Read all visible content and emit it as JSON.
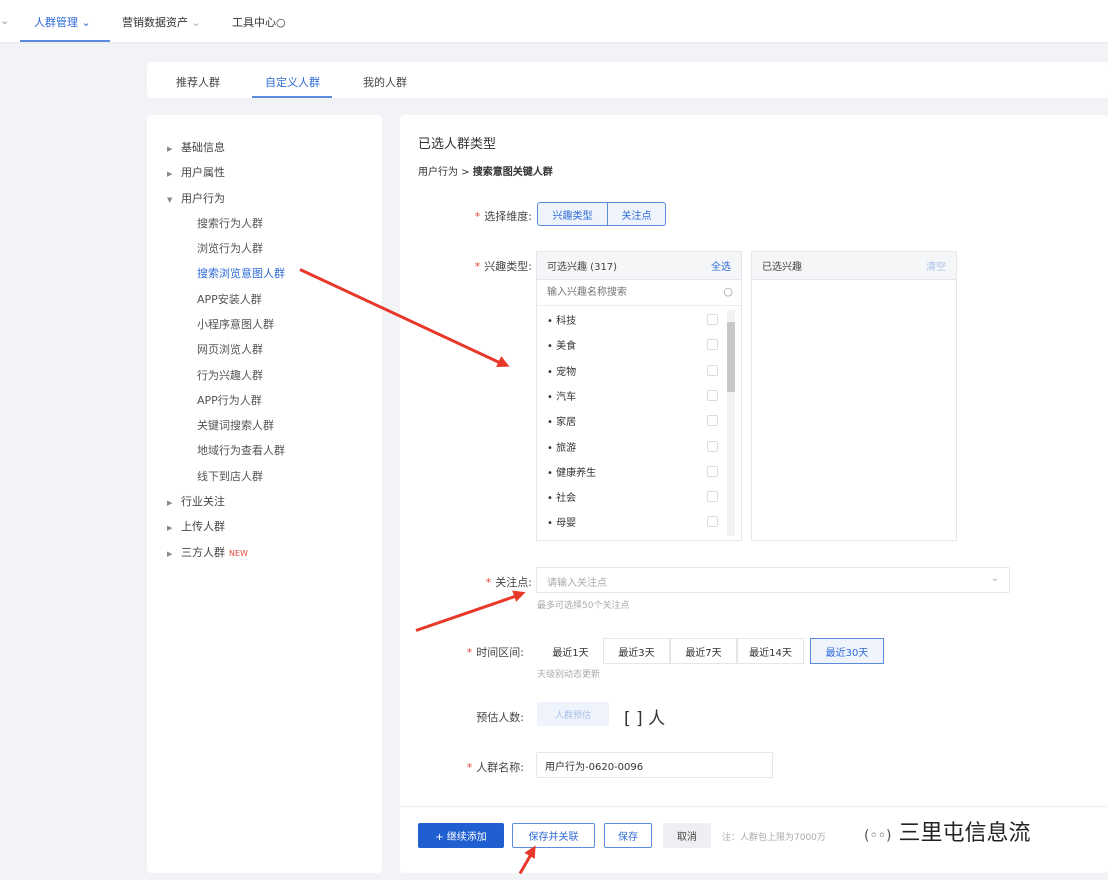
{
  "topnav": {
    "items": [
      {
        "label": "人群管理",
        "active": true
      },
      {
        "label": "营销数据资产"
      },
      {
        "label": "工具中心"
      }
    ]
  },
  "tabs": [
    {
      "label": "推荐人群"
    },
    {
      "label": "自定义人群",
      "active": true
    },
    {
      "label": "我的人群"
    }
  ],
  "tree": {
    "groups": [
      {
        "label": "基础信息"
      },
      {
        "label": "用户属性"
      },
      {
        "label": "用户行为",
        "expanded": true
      }
    ],
    "children": [
      "搜索行为人群",
      "浏览行为人群",
      "搜索浏览意图人群",
      "APP安装人群",
      "小程序意图人群",
      "网页浏览人群",
      "行为兴趣人群",
      "APP行为人群",
      "关键词搜索人群",
      "地域行为查看人群",
      "线下到店人群"
    ],
    "after": [
      "行业关注",
      "上传人群",
      "三方人群"
    ],
    "new_badge": "NEW"
  },
  "main": {
    "title": "已选人群类型",
    "breadcrumb_parent": "用户行为",
    "breadcrumb_sep": ">",
    "breadcrumb_current": "搜索意图关键人群",
    "dimension": {
      "label": "选择维度:",
      "options": [
        "兴趣类型",
        "关注点"
      ]
    },
    "interest": {
      "label": "兴趣类型:",
      "available_title": "可选兴趣 (317)",
      "select_all": "全选",
      "selected_title": "已选兴趣",
      "clear": "清空",
      "search_placeholder": "输入兴趣名称搜索",
      "items": [
        "科技",
        "美食",
        "宠物",
        "汽车",
        "家居",
        "旅游",
        "健康养生",
        "社会",
        "母婴"
      ]
    },
    "focus": {
      "label": "关注点:",
      "placeholder": "请输入关注点",
      "hint": "最多可选择50个关注点"
    },
    "time": {
      "label": "时间区间:",
      "options": [
        "最近1天",
        "最近3天",
        "最近7天",
        "最近14天",
        "最近30天"
      ],
      "selected": "最近30天",
      "hint": "天级别动态更新"
    },
    "estimate": {
      "label": "预估人数:",
      "button": "人群预估",
      "value": "[ ] 人"
    },
    "name": {
      "label": "人群名称:",
      "value": "用户行为-0620-0096"
    }
  },
  "footer": {
    "add": "+ 继续添加",
    "save_link": "保存并关联",
    "save": "保存",
    "cancel": "取消",
    "note": "注：人群包上限为7000万"
  },
  "watermark": "三里屯信息流",
  "colors": {
    "accent": "#2f6bd8",
    "arrow": "#e8382a"
  }
}
